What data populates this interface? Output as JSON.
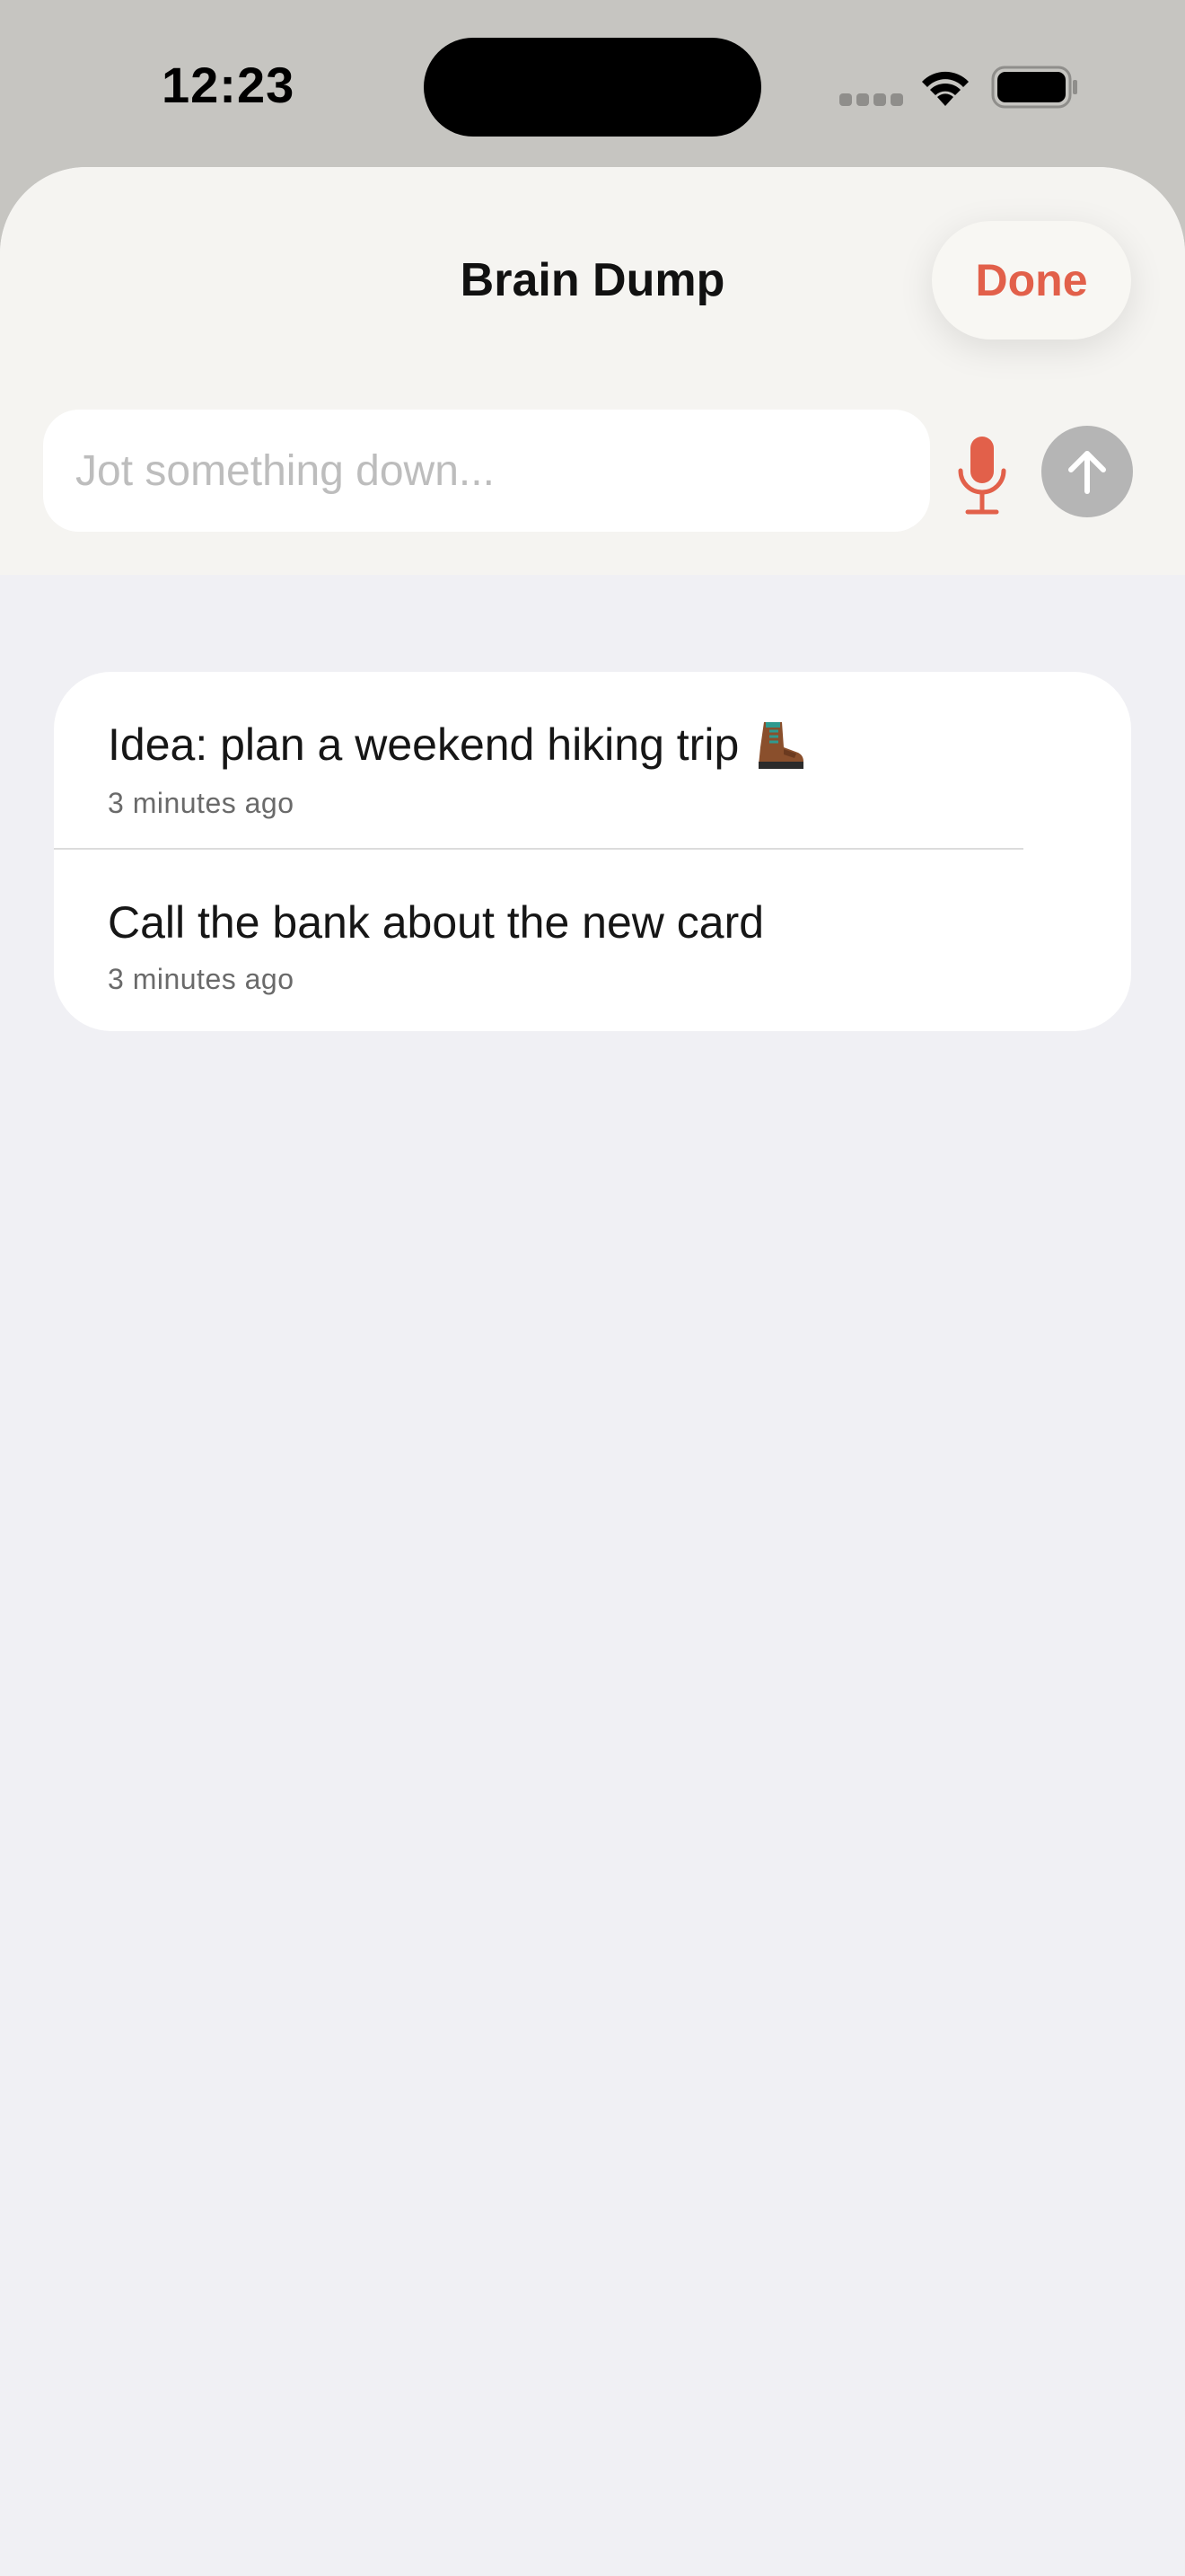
{
  "status_bar": {
    "time": "12:23"
  },
  "sheet": {
    "title": "Brain Dump",
    "done_label": "Done",
    "input": {
      "placeholder": "Jot something down...",
      "value": ""
    }
  },
  "notes": [
    {
      "text": "Idea: plan a weekend hiking trip",
      "emoji": "hiking-boot-icon",
      "time": "3 minutes ago"
    },
    {
      "text": "Call the bank about the new card",
      "time": "3 minutes ago"
    }
  ],
  "colors": {
    "accent": "#e2604a",
    "sheet_header": "#f5f4f1",
    "list_background": "#f0f0f4",
    "send_disabled": "#b5b5b5"
  }
}
